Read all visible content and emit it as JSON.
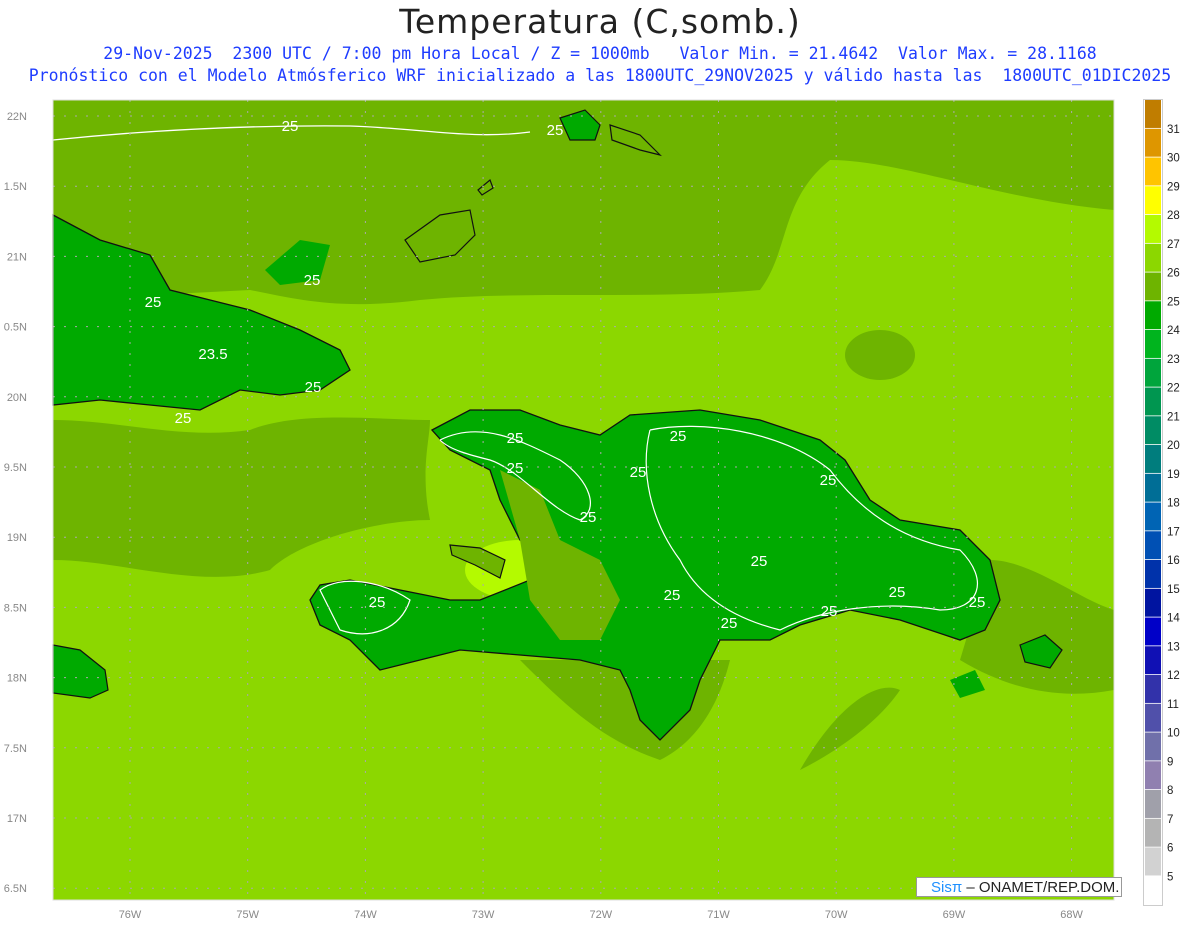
{
  "title": "Temperatura (C,somb.)",
  "subtitle_line1": "29-Nov-2025  2300 UTC / 7:00 pm Hora Local / Z = 1000mb   Valor Min. = 21.4642  Valor Max. = 28.1168",
  "subtitle_line2": "Pronóstico con el Modelo Atmósferico WRF inicializado a las 1800UTC_29NOV2025 y válido hasta las  1800UTC_01DIC2025",
  "map": {
    "lon_ticks": [
      "76W",
      "75W",
      "74W",
      "73W",
      "72W",
      "71W",
      "70W",
      "69W",
      "68W"
    ],
    "lat_ticks": [
      "22N",
      "1.5N",
      "21N",
      "0.5N",
      "20N",
      "9.5N",
      "19N",
      "8.5N",
      "18N",
      "7.5N",
      "17N",
      "6.5N"
    ],
    "contour_labels": [
      "25",
      "25",
      "25",
      "25",
      "23.5",
      "25",
      "25",
      "25",
      "25",
      "25",
      "25",
      "25",
      "25",
      "25",
      "25",
      "25",
      "25",
      "25",
      "25",
      "25"
    ],
    "colors": {
      "sea_light": "#8cd700",
      "sea_dark": "#6eb400",
      "land": "#00aa00",
      "land_dark": "#00a01e",
      "warm": "#b4fa00"
    }
  },
  "colorbar": {
    "labels": [
      "31",
      "30",
      "29",
      "28",
      "27",
      "26",
      "25",
      "24",
      "23",
      "22",
      "21",
      "20",
      "19",
      "18",
      "17",
      "16",
      "15",
      "14",
      "13",
      "12",
      "11",
      "10",
      "9",
      "8",
      "7",
      "6",
      "5"
    ],
    "colors": [
      "#c07d00",
      "#de9600",
      "#ffc400",
      "#ffff00",
      "#b4fa00",
      "#8cd700",
      "#6eb400",
      "#00aa00",
      "#00b41e",
      "#00a53c",
      "#009650",
      "#008c64",
      "#007d7d",
      "#006e96",
      "#0064b4",
      "#0050b4",
      "#0032aa",
      "#0014a0",
      "#0000c8",
      "#1010b4",
      "#3232aa",
      "#5050aa",
      "#7070aa",
      "#9080b0",
      "#a0a0aa",
      "#b4b4b4",
      "#d2d2d2",
      "#ffffff"
    ]
  },
  "credit": {
    "brand": "Sisπ",
    "text": " – ONAMET/REP.DOM."
  }
}
